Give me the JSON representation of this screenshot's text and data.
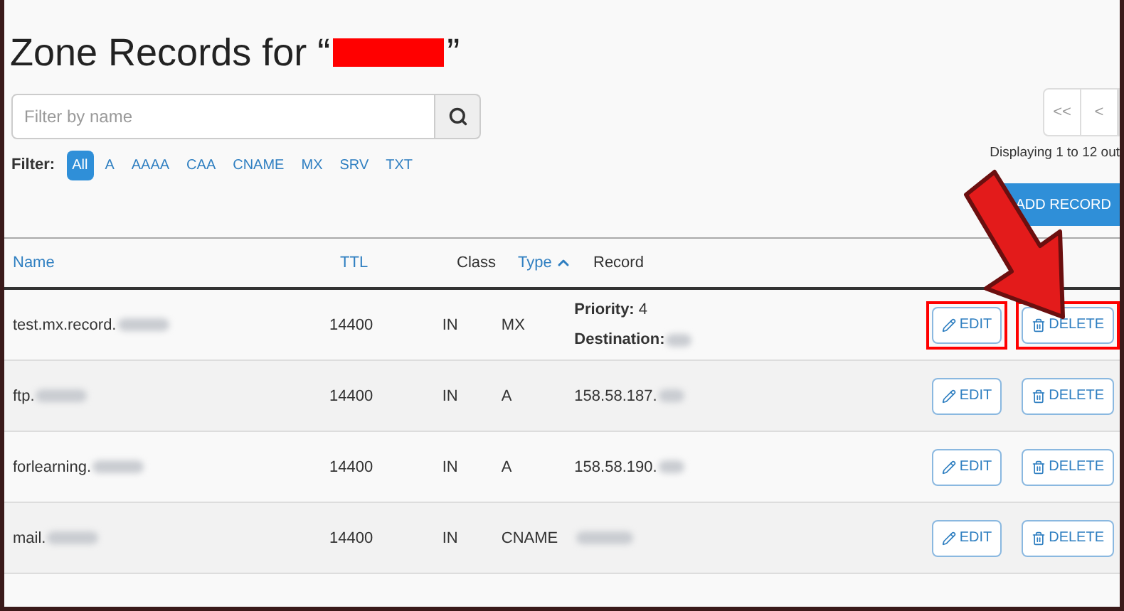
{
  "title": {
    "text": "Zone Records for “",
    "closing": "”",
    "redacted": true
  },
  "search": {
    "placeholder": "Filter by name"
  },
  "filter": {
    "label": "Filter:",
    "options": [
      {
        "label": "All",
        "selected": true
      },
      {
        "label": "A",
        "selected": false
      },
      {
        "label": "AAAA",
        "selected": false
      },
      {
        "label": "CAA",
        "selected": false
      },
      {
        "label": "CNAME",
        "selected": false
      },
      {
        "label": "MX",
        "selected": false
      },
      {
        "label": "SRV",
        "selected": false
      },
      {
        "label": "TXT",
        "selected": false
      }
    ]
  },
  "pagination": {
    "buttons": [
      "<<",
      "<"
    ],
    "summary": "Displaying 1 to 12 out"
  },
  "add_button": "ADD RECORD",
  "table": {
    "columns": [
      {
        "label": "Name",
        "sortable": true,
        "sorted": false
      },
      {
        "label": "TTL",
        "sortable": true,
        "sorted": false
      },
      {
        "label": "Class",
        "sortable": false,
        "sorted": false
      },
      {
        "label": "Type",
        "sortable": true,
        "sorted": true
      },
      {
        "label": "Record",
        "sortable": false,
        "sorted": false
      }
    ],
    "rows": [
      {
        "name": "test.mx.record.",
        "ttl": "14400",
        "class": "IN",
        "type": "MX",
        "record_lines": [
          {
            "text": "**Priority:** 4",
            "blurred": false
          },
          {
            "text": "**Destination:**",
            "blurred": true
          }
        ],
        "highlighted": true,
        "edit": "EDIT",
        "delete": "DELETE"
      },
      {
        "name": "ftp.",
        "ttl": "14400",
        "class": "IN",
        "type": "A",
        "record_lines": [
          {
            "text": "158.58.187.",
            "blurred": true
          }
        ],
        "highlighted": false,
        "edit": "EDIT",
        "delete": "DELETE"
      },
      {
        "name": "forlearning.",
        "ttl": "14400",
        "class": "IN",
        "type": "A",
        "record_lines": [
          {
            "text": "158.58.190.",
            "blurred": true
          }
        ],
        "highlighted": false,
        "edit": "EDIT",
        "delete": "DELETE"
      },
      {
        "name": "mail.",
        "ttl": "14400",
        "class": "IN",
        "type": "CNAME",
        "record_lines": [
          {
            "blurred": true
          }
        ],
        "highlighted": false,
        "edit": "EDIT",
        "delete": "DELETE"
      }
    ]
  },
  "annotation": {
    "arrow": true
  }
}
